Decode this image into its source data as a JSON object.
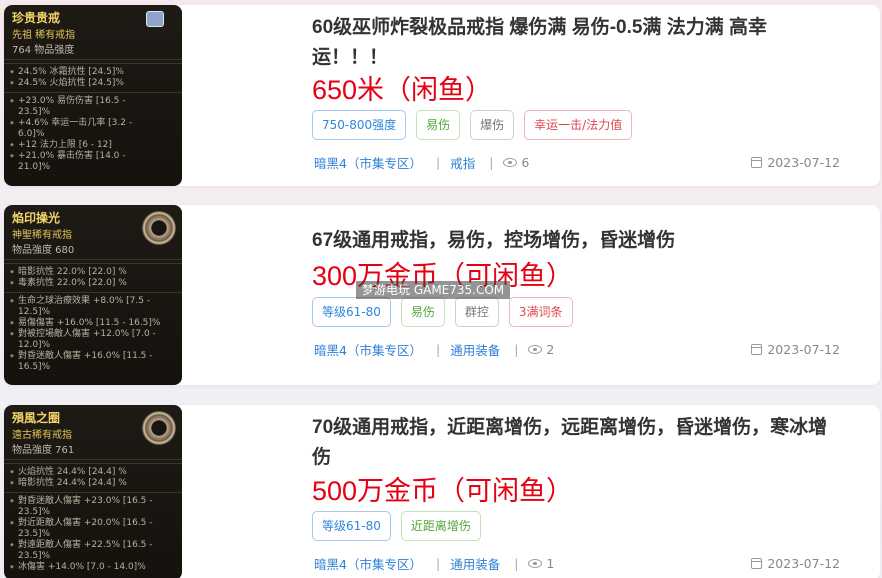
{
  "listings": [
    {
      "thumb": {
        "header": "珍贵贵戒",
        "subtitle": "先祖 稀有戒指",
        "power": "764 物品强度",
        "lines_a": [
          "24.5% 冰霜抗性 [24.5]%",
          "24.5% 火焰抗性 [24.5]%"
        ],
        "lines_b": [
          "+23.0% 易伤伤害 [16.5 -\n23.5]%",
          "+4.6% 幸运一击几率 [3.2 -\n6.0]%",
          "+12 法力上限 [6 - 12]",
          "+21.0% 暴击伤害 [14.0 -\n21.0]%"
        ]
      },
      "title": "60级巫师炸裂极品戒指 爆伤满 易伤-0.5满 法力满 高幸运！！！",
      "price": "650米（闲鱼）",
      "tags": [
        {
          "label": "750-800强度",
          "color": "blue"
        },
        {
          "label": "易伤",
          "color": "green"
        },
        {
          "label": "爆伤",
          "color": "gray"
        },
        {
          "label": "幸运一击/法力值",
          "color": "red"
        }
      ],
      "zone": "暗黑4（市集专区）",
      "category": "戒指",
      "views": "6",
      "date": "2023-07-12"
    },
    {
      "thumb": {
        "header": "焰印操光",
        "subtitle": "神聖稀有戒指",
        "power": "物品強度 680",
        "lines_a": [
          "暗影抗性 22.0% [22.0] %",
          "毒素抗性 22.0% [22.0] %"
        ],
        "lines_b": [
          "生命之球治療效果 +8.0% [7.5 -\n12.5]%",
          "易傷傷害 +16.0% [11.5 - 16.5]%",
          "對被控場敵人傷害 +12.0% [7.0 -\n12.0]%",
          "對昏迷敵人傷害 +16.0% [11.5 -\n16.5]%"
        ]
      },
      "title": "67级通用戒指，易伤，控场增伤，昏迷增伤",
      "price": "300万金币（可闲鱼）",
      "tags": [
        {
          "label": "等级61-80",
          "color": "blue"
        },
        {
          "label": "易伤",
          "color": "green"
        },
        {
          "label": "群控",
          "color": "gray"
        },
        {
          "label": "3满词条",
          "color": "red"
        }
      ],
      "zone": "暗黑4（市集专区）",
      "category": "通用装备",
      "views": "2",
      "date": "2023-07-12"
    },
    {
      "thumb": {
        "header": "殞風之圈",
        "subtitle": "遠古稀有戒指",
        "power": "物品強度 761",
        "lines_a": [
          "火焰抗性 24.4% [24.4] %",
          "暗影抗性 24.4% [24.4] %"
        ],
        "lines_b": [
          "對昏迷敵人傷害 +23.0% [16.5 -\n23.5]%",
          "對近距敵人傷害 +20.0% [16.5 -\n23.5]%",
          "對遠距敵人傷害 +22.5% [16.5 -\n23.5]%",
          "冰傷害 +14.0% [7.0 - 14.0]%"
        ]
      },
      "title": "70级通用戒指，近距离增伤，远距离增伤，昏迷增伤，寒冰增伤",
      "price": "500万金币（可闲鱼）",
      "tags": [
        {
          "label": "等级61-80",
          "color": "blue"
        },
        {
          "label": "近距离增伤",
          "color": "green"
        }
      ],
      "zone": "暗黑4（市集专区）",
      "category": "通用装备",
      "views": "1",
      "date": "2023-07-12"
    }
  ],
  "watermark": "梦游电玩 GAME735.COM",
  "icons": {
    "views": "eye-icon",
    "date": "calendar-icon"
  }
}
